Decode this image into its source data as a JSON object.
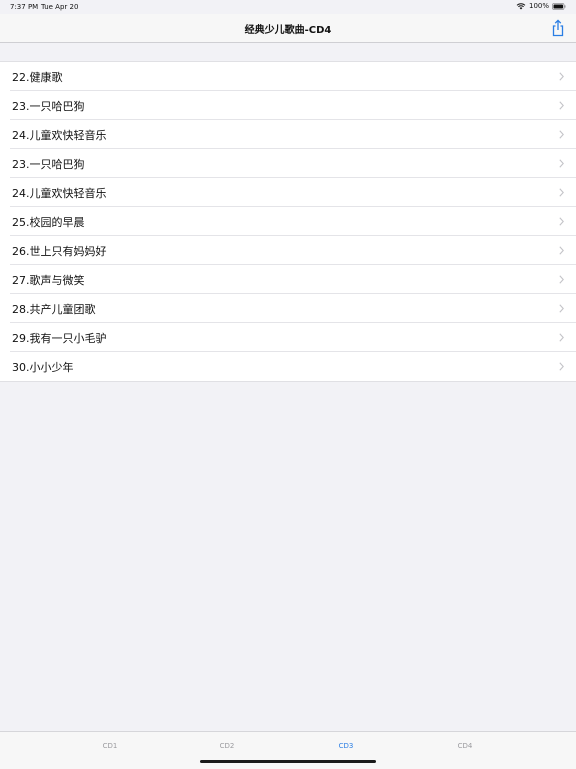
{
  "status": {
    "time": "7:37 PM",
    "date": "Tue Apr 20",
    "battery": "100%"
  },
  "nav": {
    "title": "经典少儿歌曲-CD4",
    "share_icon": "share-icon"
  },
  "items": [
    {
      "label": "22.健康歌"
    },
    {
      "label": "23.一只哈巴狗"
    },
    {
      "label": "24.儿童欢快轻音乐"
    },
    {
      "label": "23.一只哈巴狗"
    },
    {
      "label": "24.儿童欢快轻音乐"
    },
    {
      "label": "25.校园的早晨"
    },
    {
      "label": "26.世上只有妈妈好"
    },
    {
      "label": "27.歌声与微笑"
    },
    {
      "label": "28.共产儿童团歌"
    },
    {
      "label": "29.我有一只小毛驴"
    },
    {
      "label": "30.小小少年"
    }
  ],
  "tabs": [
    {
      "label": "CD1",
      "active": false
    },
    {
      "label": "CD2",
      "active": false
    },
    {
      "label": "CD3",
      "active": true
    },
    {
      "label": "CD4",
      "active": false
    }
  ],
  "colors": {
    "accent": "#2a7ee4",
    "background": "#f2f2f6",
    "inactive_tab": "#9a9a9e"
  }
}
